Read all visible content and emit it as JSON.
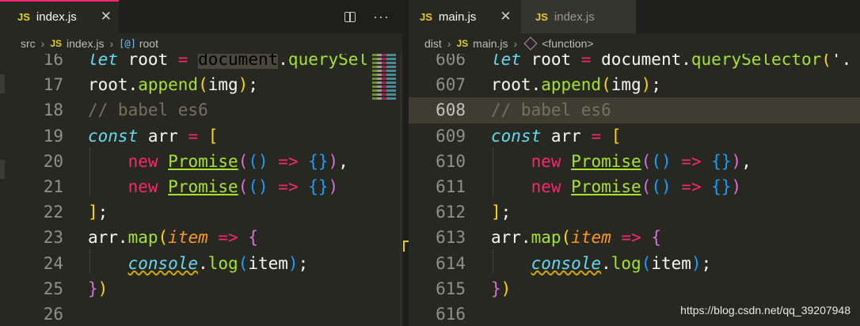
{
  "left_editor": {
    "tab": {
      "icon": "JS",
      "label": "index.js",
      "close": "✕"
    },
    "actions": {
      "split": "split-editor-icon",
      "more": "···"
    },
    "breadcrumb": {
      "folder": "src",
      "file_icon": "JS",
      "file": "index.js",
      "symbol_icon": "[@]",
      "symbol": "root"
    },
    "lines": [
      {
        "num": "16",
        "tokens": [
          [
            "kw",
            "let"
          ],
          [
            "plain",
            " root "
          ],
          [
            "op",
            "="
          ],
          [
            "plain",
            " "
          ],
          [
            "sel",
            "document"
          ],
          [
            "plain",
            "."
          ],
          [
            "fn",
            "querySel"
          ]
        ]
      },
      {
        "num": "17",
        "tokens": [
          [
            "plain",
            "root."
          ],
          [
            "fn",
            "append"
          ],
          [
            "p1",
            "("
          ],
          [
            "plain",
            "img"
          ],
          [
            "p1",
            ")"
          ],
          [
            "plain",
            ";"
          ]
        ]
      },
      {
        "num": "18",
        "tokens": [
          [
            "cm",
            "// babel es6"
          ]
        ]
      },
      {
        "num": "19",
        "tokens": [
          [
            "kw",
            "const"
          ],
          [
            "plain",
            " arr "
          ],
          [
            "op",
            "="
          ],
          [
            "plain",
            " "
          ],
          [
            "p1",
            "["
          ]
        ]
      },
      {
        "num": "20",
        "tokens": [
          [
            "plain",
            "    "
          ],
          [
            "new",
            "new"
          ],
          [
            "plain",
            " "
          ],
          [
            "cls",
            "Promise"
          ],
          [
            "p2",
            "("
          ],
          [
            "p3",
            "()"
          ],
          [
            "plain",
            " "
          ],
          [
            "op",
            "=>"
          ],
          [
            "plain",
            " "
          ],
          [
            "p3",
            "{}"
          ],
          [
            "p2",
            ")"
          ],
          [
            "plain",
            ","
          ]
        ]
      },
      {
        "num": "21",
        "tokens": [
          [
            "plain",
            "    "
          ],
          [
            "new",
            "new"
          ],
          [
            "plain",
            " "
          ],
          [
            "cls",
            "Promise"
          ],
          [
            "p2",
            "("
          ],
          [
            "p3",
            "()"
          ],
          [
            "plain",
            " "
          ],
          [
            "op",
            "=>"
          ],
          [
            "plain",
            " "
          ],
          [
            "p3",
            "{}"
          ],
          [
            "p2",
            ")"
          ]
        ]
      },
      {
        "num": "22",
        "tokens": [
          [
            "p1",
            "]"
          ],
          [
            "plain",
            ";"
          ]
        ]
      },
      {
        "num": "23",
        "tokens": [
          [
            "plain",
            "arr."
          ],
          [
            "fn",
            "map"
          ],
          [
            "p1",
            "("
          ],
          [
            "param",
            "item"
          ],
          [
            "plain",
            " "
          ],
          [
            "op",
            "=>"
          ],
          [
            "plain",
            " "
          ],
          [
            "p2",
            "{"
          ]
        ]
      },
      {
        "num": "24",
        "tokens": [
          [
            "plain",
            "    "
          ],
          [
            "con",
            "console"
          ],
          [
            "plain",
            "."
          ],
          [
            "fn",
            "log"
          ],
          [
            "p3",
            "("
          ],
          [
            "plain",
            "item"
          ],
          [
            "p3",
            ")"
          ],
          [
            "plain",
            ";"
          ]
        ]
      },
      {
        "num": "25",
        "tokens": [
          [
            "p2",
            "}"
          ],
          [
            "p1",
            ")"
          ]
        ]
      },
      {
        "num": "26",
        "tokens": []
      }
    ]
  },
  "right_editor": {
    "tabs": [
      {
        "icon": "JS",
        "label": "main.js",
        "close": "✕"
      },
      {
        "icon": "JS",
        "label": "index.js"
      }
    ],
    "breadcrumb": {
      "folder": "dist",
      "file_icon": "JS",
      "file": "main.js",
      "symbol": "<function>"
    },
    "lines": [
      {
        "num": "606",
        "tokens": [
          [
            "kw",
            "let"
          ],
          [
            "plain",
            " root "
          ],
          [
            "op",
            "="
          ],
          [
            "plain",
            " document."
          ],
          [
            "fn",
            "querySelector"
          ],
          [
            "p1",
            "("
          ],
          [
            "plain",
            "'."
          ]
        ]
      },
      {
        "num": "607",
        "tokens": [
          [
            "plain",
            "root."
          ],
          [
            "fn",
            "append"
          ],
          [
            "p1",
            "("
          ],
          [
            "plain",
            "img"
          ],
          [
            "p1",
            ")"
          ],
          [
            "plain",
            ";"
          ]
        ]
      },
      {
        "num": "608",
        "current": true,
        "tokens": [
          [
            "cm",
            "// babel es6"
          ]
        ]
      },
      {
        "num": "609",
        "tokens": [
          [
            "kw",
            "const"
          ],
          [
            "plain",
            " arr "
          ],
          [
            "op",
            "="
          ],
          [
            "plain",
            " "
          ],
          [
            "p1",
            "["
          ]
        ]
      },
      {
        "num": "610",
        "tokens": [
          [
            "plain",
            "    "
          ],
          [
            "new",
            "new"
          ],
          [
            "plain",
            " "
          ],
          [
            "cls",
            "Promise"
          ],
          [
            "p2",
            "("
          ],
          [
            "p3",
            "()"
          ],
          [
            "plain",
            " "
          ],
          [
            "op",
            "=>"
          ],
          [
            "plain",
            " "
          ],
          [
            "p3",
            "{}"
          ],
          [
            "p2",
            ")"
          ],
          [
            "plain",
            ","
          ]
        ]
      },
      {
        "num": "611",
        "tokens": [
          [
            "plain",
            "    "
          ],
          [
            "new",
            "new"
          ],
          [
            "plain",
            " "
          ],
          [
            "cls",
            "Promise"
          ],
          [
            "p2",
            "("
          ],
          [
            "p3",
            "()"
          ],
          [
            "plain",
            " "
          ],
          [
            "op",
            "=>"
          ],
          [
            "plain",
            " "
          ],
          [
            "p3",
            "{}"
          ],
          [
            "p2",
            ")"
          ]
        ]
      },
      {
        "num": "612",
        "tokens": [
          [
            "p1",
            "]"
          ],
          [
            "plain",
            ";"
          ]
        ]
      },
      {
        "num": "613",
        "tokens": [
          [
            "plain",
            "arr."
          ],
          [
            "fn",
            "map"
          ],
          [
            "p1",
            "("
          ],
          [
            "param",
            "item"
          ],
          [
            "plain",
            " "
          ],
          [
            "op",
            "=>"
          ],
          [
            "plain",
            " "
          ],
          [
            "p2",
            "{"
          ]
        ]
      },
      {
        "num": "614",
        "tokens": [
          [
            "plain",
            "    "
          ],
          [
            "con",
            "console"
          ],
          [
            "plain",
            "."
          ],
          [
            "fn",
            "log"
          ],
          [
            "p3",
            "("
          ],
          [
            "plain",
            "item"
          ],
          [
            "p3",
            ")"
          ],
          [
            "plain",
            ";"
          ]
        ]
      },
      {
        "num": "615",
        "tokens": [
          [
            "p2",
            "}"
          ],
          [
            "p1",
            ")"
          ]
        ]
      },
      {
        "num": "616",
        "tokens": []
      }
    ]
  },
  "watermark": "https://blog.csdn.net/qq_39207948",
  "colors": {
    "accent_tab": "#f92672",
    "js_badge": "#e6cd29",
    "background": "#272822"
  }
}
